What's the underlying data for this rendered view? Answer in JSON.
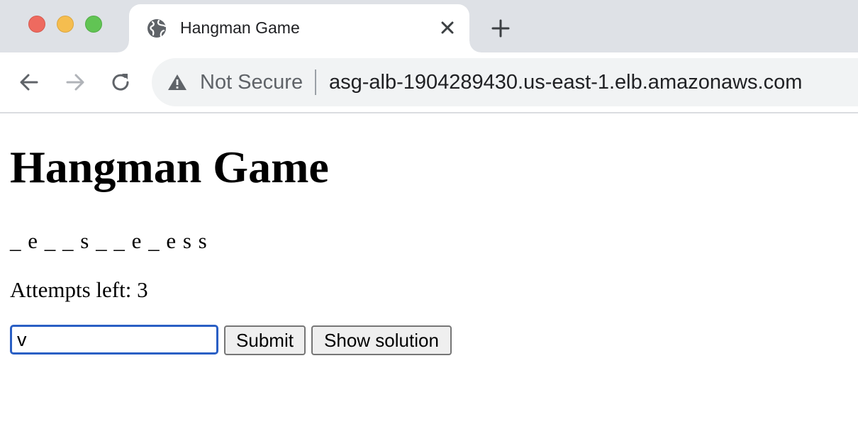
{
  "browser": {
    "tab": {
      "title": "Hangman Game",
      "favicon": "globe-icon"
    },
    "toolbar": {
      "security_label": "Not Secure",
      "url": "asg-alb-1904289430.us-east-1.elb.amazonaws.com"
    },
    "colors": {
      "close": "#ee6a5f",
      "minimize": "#f5bd4f",
      "maximize": "#61c454",
      "focus_ring": "#2a5fc4"
    }
  },
  "page": {
    "title": "Hangman Game",
    "word_display": "_ e _ _ s _ _ e _ e s s",
    "attempts_text": "Attempts left: 3",
    "guess_input_value": "v",
    "submit_label": "Submit",
    "show_solution_label": "Show solution"
  }
}
